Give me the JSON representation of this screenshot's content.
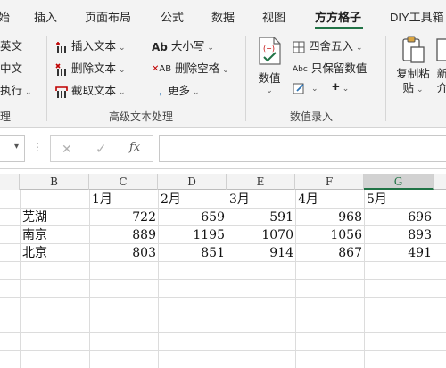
{
  "tabs": [
    "始",
    "插入",
    "页面布局",
    "公式",
    "数据",
    "视图",
    "方方格子",
    "DIY工具箱"
  ],
  "active_tab": "方方格子",
  "accent_color": "#217346",
  "ribbon": {
    "left_items": [
      "英文",
      "中文",
      "执行"
    ],
    "left_group_label": "理",
    "text_group": {
      "items": [
        "插入文本",
        "删除文本",
        "截取文本",
        "大小写",
        "删除空格",
        "更多"
      ],
      "label": "高级文本处理"
    },
    "numeric_group": {
      "big_button_label": "数值",
      "items": [
        "四舍五入",
        "只保留数值"
      ],
      "label": "数值录入"
    },
    "copy_paste": [
      "复制粘",
      "贴"
    ],
    "new_button": [
      "新",
      "介"
    ]
  },
  "formula_bar": {
    "cancel_symbol": "✕",
    "enter_symbol": "✓",
    "fx_label": "fx",
    "value": ""
  },
  "sheet": {
    "columns": [
      "B",
      "C",
      "D",
      "E",
      "F",
      "G"
    ],
    "selected_column": "G",
    "header_row": [
      "",
      "1月",
      "2月",
      "3月",
      "4月",
      "5月"
    ],
    "rows": [
      {
        "city": "芜湖",
        "values": [
          "722",
          "659",
          "591",
          "968",
          "696"
        ]
      },
      {
        "city": "南京",
        "values": [
          "889",
          "1195",
          "1070",
          "1056",
          "893"
        ]
      },
      {
        "city": "北京",
        "values": [
          "803",
          "851",
          "914",
          "867",
          "491"
        ]
      }
    ]
  }
}
